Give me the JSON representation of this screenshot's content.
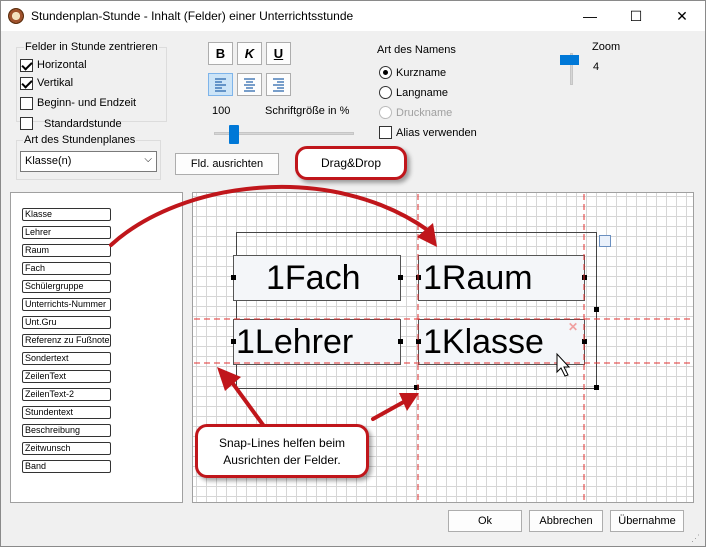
{
  "window": {
    "title": "Stundenplan-Stunde - Inhalt (Felder) einer Unterrichtsstunde",
    "minimize": "—",
    "maximize": "☐",
    "close": "✕"
  },
  "center": {
    "heading": "Felder in Stunde zentrieren",
    "horizontal": "Horizontal",
    "vertikal": "Vertikal"
  },
  "options": {
    "beginn_endzeit": "Beginn- und Endzeit",
    "standardstunde": "Standardstunde"
  },
  "plan_type": {
    "heading": "Art des Stundenplanes",
    "selected": "Klasse(n)"
  },
  "format": {
    "bold": "B",
    "italic": "K",
    "underline": "U",
    "font_size_value": "100",
    "font_size_label": "Schriftgröße in %",
    "align_button": "Fld. ausrichten"
  },
  "name_type": {
    "heading": "Art des Namens",
    "kurzname": "Kurzname",
    "langname": "Langname",
    "druckname": "Druckname",
    "alias": "Alias verwenden"
  },
  "zoom": {
    "label": "Zoom",
    "value": "4"
  },
  "field_list": [
    "Klasse",
    "Lehrer",
    "Raum",
    "Fach",
    "Schülergruppe",
    "Unterrichts-Nummer",
    "Unt.Gru",
    "Referenz zu Fußnote",
    "Sondertext",
    "ZeilenText",
    "ZeilenText-2",
    "Stundentext",
    "Beschreibung",
    "Zeitwunsch",
    "Band"
  ],
  "canvas_fields": {
    "fach": "1Fach",
    "raum": "1Raum",
    "lehrer": "1Lehrer",
    "klasse": "1Klasse"
  },
  "callouts": {
    "dragdrop": "Drag&Drop",
    "snap_line1": "Snap-Lines helfen beim",
    "snap_line2": "Ausrichten der Felder."
  },
  "buttons": {
    "ok": "Ok",
    "cancel": "Abbrechen",
    "apply": "Übernahme"
  },
  "colors": {
    "accent": "#0078d7",
    "callout_red": "#c0161b",
    "snapline": "#e03030"
  }
}
